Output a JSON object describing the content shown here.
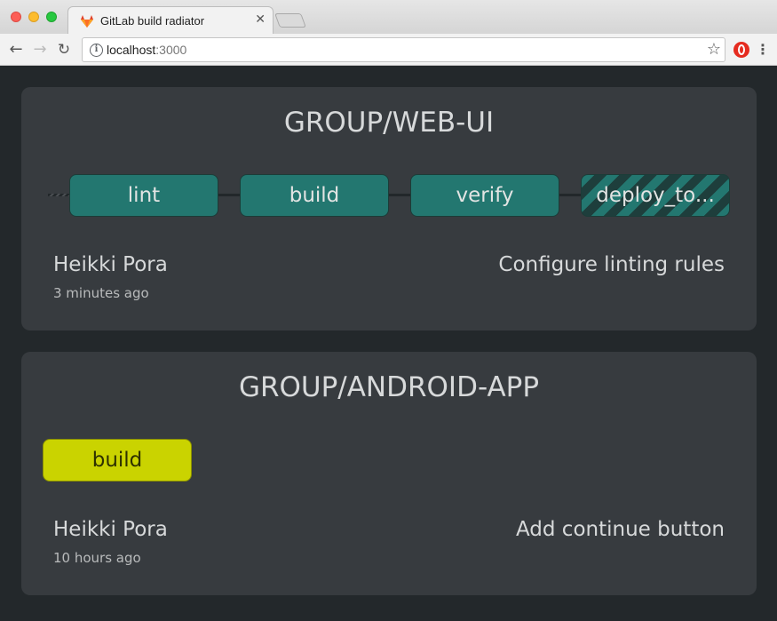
{
  "browser": {
    "tab_title": "GitLab build radiator",
    "url_host": "localhost",
    "url_port": ":3000",
    "close_glyph": "✕"
  },
  "projects": [
    {
      "name": "GROUP/WEB-UI",
      "stages": [
        {
          "label": "lint",
          "status": "success"
        },
        {
          "label": "build",
          "status": "success"
        },
        {
          "label": "verify",
          "status": "success"
        },
        {
          "label": "deploy_to...",
          "status": "running"
        }
      ],
      "author": "Heikki Pora",
      "time": "3 minutes ago",
      "commit": "Configure linting rules"
    },
    {
      "name": "GROUP/ANDROID-APP",
      "stages": [
        {
          "label": "build",
          "status": "manual"
        }
      ],
      "author": "Heikki Pora",
      "time": "10 hours ago",
      "commit": "Add continue button"
    }
  ],
  "colors": {
    "background": "#23282b",
    "card": "#373b3f",
    "stage_success": "#237770",
    "stage_manual": "#cad300"
  }
}
